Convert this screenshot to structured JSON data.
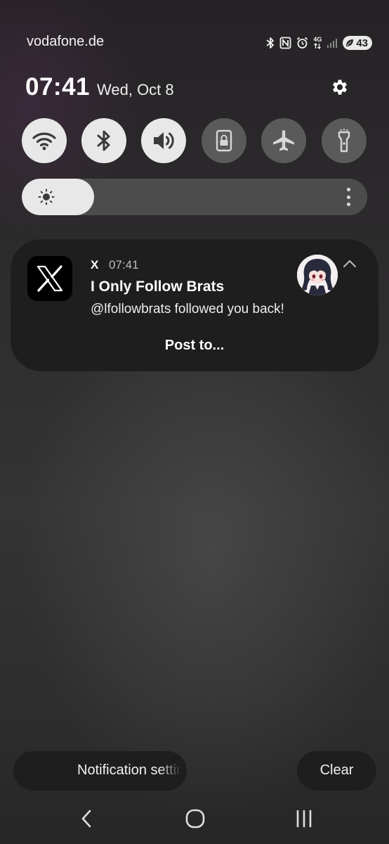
{
  "status_bar": {
    "carrier": "vodafone.de",
    "network_type": "4G",
    "battery_level": "43",
    "icons": [
      "bluetooth-icon",
      "nfc-icon",
      "alarm-icon",
      "network-type-icon",
      "signal-icon",
      "battery-saver-icon"
    ]
  },
  "header": {
    "time": "07:41",
    "date": "Wed, Oct 8",
    "settings_icon": "gear-icon"
  },
  "quick_tiles": [
    {
      "name": "Wi-Fi",
      "icon": "wifi-icon",
      "state": "on"
    },
    {
      "name": "Bluetooth",
      "icon": "bluetooth-icon",
      "state": "on"
    },
    {
      "name": "Sound",
      "icon": "volume-icon",
      "state": "on"
    },
    {
      "name": "Rotation lock",
      "icon": "lock-icon",
      "state": "off"
    },
    {
      "name": "Airplane mode",
      "icon": "airplane-icon",
      "state": "off"
    },
    {
      "name": "Flashlight",
      "icon": "flashlight-icon",
      "state": "off"
    }
  ],
  "brightness": {
    "level": 0.21,
    "icon": "sun-icon",
    "more_icon": "more-vertical-icon"
  },
  "notification": {
    "app_name": "X",
    "time": "07:41",
    "title": "I Only Follow Brats",
    "body": "@lfollowbrats followed you back!",
    "action": "Post to...",
    "app_icon": "x-logo-icon",
    "collapse_icon": "chevron-up-icon"
  },
  "bottom_actions": {
    "notification_settings": "Notification settings",
    "clear": "Clear"
  },
  "nav_bar": {
    "icons": [
      "back-icon",
      "home-icon",
      "recents-icon"
    ]
  },
  "colors": {
    "tile_on": "#e8e8e8",
    "tile_off": "#5a5a5a",
    "card": "#1e1e1e",
    "background": "#2e2e2e"
  }
}
